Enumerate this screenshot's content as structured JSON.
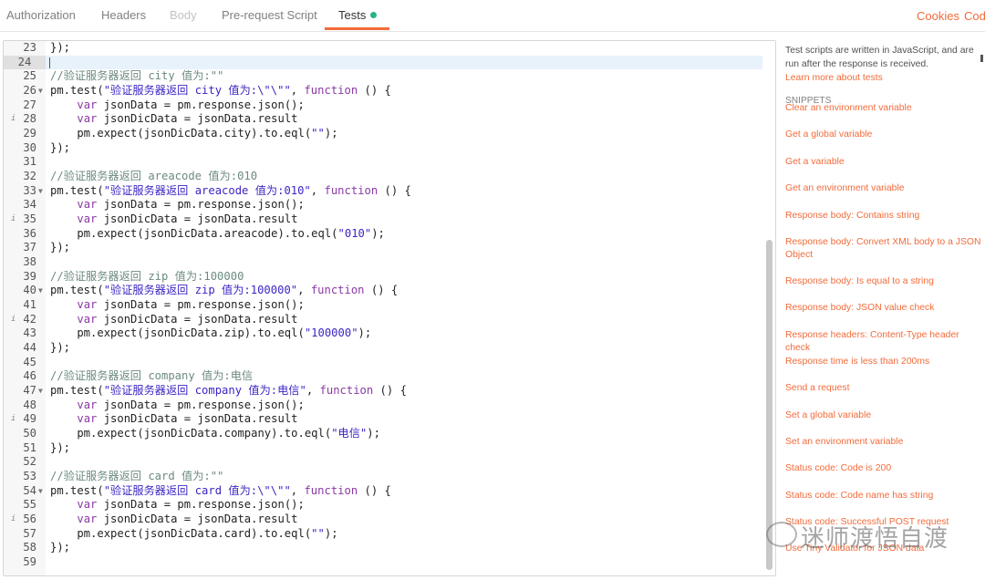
{
  "tabs": [
    {
      "label": "Authorization"
    },
    {
      "label": "Headers"
    },
    {
      "label": "Body"
    },
    {
      "label": "Pre-request Script"
    },
    {
      "label": "Tests"
    }
  ],
  "top_right": {
    "cookies": "Cookies",
    "code": "Code"
  },
  "editor": {
    "lines": [
      {
        "n": "23",
        "t": [
          [
            "});",
            ""
          ]
        ]
      },
      {
        "n": "24",
        "t": []
      },
      {
        "n": "25",
        "t": [
          [
            "//验证服务器返回 city 值为:\"\"",
            "cm"
          ]
        ]
      },
      {
        "n": "26",
        "fold": true,
        "t": [
          [
            "pm.test(",
            ""
          ],
          [
            "\"验证服务器返回 city 值为:\\\"\\\"\"",
            "st"
          ],
          [
            ", ",
            ""
          ],
          [
            "function",
            "kw"
          ],
          [
            " () {",
            ""
          ]
        ]
      },
      {
        "n": "27",
        "t": [
          [
            "    ",
            ""
          ],
          [
            "var",
            "kw"
          ],
          [
            " jsonData = pm.response.json();",
            ""
          ]
        ]
      },
      {
        "n": "28",
        "info": true,
        "t": [
          [
            "    ",
            ""
          ],
          [
            "var",
            "kw"
          ],
          [
            " jsonDicData = jsonData.result",
            ""
          ]
        ]
      },
      {
        "n": "29",
        "t": [
          [
            "    pm.expect(jsonDicData.city).to.eql(",
            ""
          ],
          [
            "\"\"",
            "st"
          ],
          [
            ");",
            ""
          ]
        ]
      },
      {
        "n": "30",
        "t": [
          [
            "});",
            ""
          ]
        ]
      },
      {
        "n": "31",
        "t": []
      },
      {
        "n": "32",
        "t": [
          [
            "//验证服务器返回 areacode 值为:010",
            "cm"
          ]
        ]
      },
      {
        "n": "33",
        "fold": true,
        "t": [
          [
            "pm.test(",
            ""
          ],
          [
            "\"验证服务器返回 areacode 值为:010\"",
            "st"
          ],
          [
            ", ",
            ""
          ],
          [
            "function",
            "kw"
          ],
          [
            " () {",
            ""
          ]
        ]
      },
      {
        "n": "34",
        "t": [
          [
            "    ",
            ""
          ],
          [
            "var",
            "kw"
          ],
          [
            " jsonData = pm.response.json();",
            ""
          ]
        ]
      },
      {
        "n": "35",
        "info": true,
        "t": [
          [
            "    ",
            ""
          ],
          [
            "var",
            "kw"
          ],
          [
            " jsonDicData = jsonData.result",
            ""
          ]
        ]
      },
      {
        "n": "36",
        "t": [
          [
            "    pm.expect(jsonDicData.areacode).to.eql(",
            ""
          ],
          [
            "\"010\"",
            "st"
          ],
          [
            ");",
            ""
          ]
        ]
      },
      {
        "n": "37",
        "t": [
          [
            "});",
            ""
          ]
        ]
      },
      {
        "n": "38",
        "t": []
      },
      {
        "n": "39",
        "t": [
          [
            "//验证服务器返回 zip 值为:100000",
            "cm"
          ]
        ]
      },
      {
        "n": "40",
        "fold": true,
        "t": [
          [
            "pm.test(",
            ""
          ],
          [
            "\"验证服务器返回 zip 值为:100000\"",
            "st"
          ],
          [
            ", ",
            ""
          ],
          [
            "function",
            "kw"
          ],
          [
            " () {",
            ""
          ]
        ]
      },
      {
        "n": "41",
        "t": [
          [
            "    ",
            ""
          ],
          [
            "var",
            "kw"
          ],
          [
            " jsonData = pm.response.json();",
            ""
          ]
        ]
      },
      {
        "n": "42",
        "info": true,
        "t": [
          [
            "    ",
            ""
          ],
          [
            "var",
            "kw"
          ],
          [
            " jsonDicData = jsonData.result",
            ""
          ]
        ]
      },
      {
        "n": "43",
        "t": [
          [
            "    pm.expect(jsonDicData.zip).to.eql(",
            ""
          ],
          [
            "\"100000\"",
            "st"
          ],
          [
            ");",
            ""
          ]
        ]
      },
      {
        "n": "44",
        "t": [
          [
            "});",
            ""
          ]
        ]
      },
      {
        "n": "45",
        "t": []
      },
      {
        "n": "46",
        "t": [
          [
            "//验证服务器返回 company 值为:电信",
            "cm"
          ]
        ]
      },
      {
        "n": "47",
        "fold": true,
        "t": [
          [
            "pm.test(",
            ""
          ],
          [
            "\"验证服务器返回 company 值为:电信\"",
            "st"
          ],
          [
            ", ",
            ""
          ],
          [
            "function",
            "kw"
          ],
          [
            " () {",
            ""
          ]
        ]
      },
      {
        "n": "48",
        "t": [
          [
            "    ",
            ""
          ],
          [
            "var",
            "kw"
          ],
          [
            " jsonData = pm.response.json();",
            ""
          ]
        ]
      },
      {
        "n": "49",
        "info": true,
        "t": [
          [
            "    ",
            ""
          ],
          [
            "var",
            "kw"
          ],
          [
            " jsonDicData = jsonData.result",
            ""
          ]
        ]
      },
      {
        "n": "50",
        "t": [
          [
            "    pm.expect(jsonDicData.company).to.eql(",
            ""
          ],
          [
            "\"电信\"",
            "st"
          ],
          [
            ");",
            ""
          ]
        ]
      },
      {
        "n": "51",
        "t": [
          [
            "});",
            ""
          ]
        ]
      },
      {
        "n": "52",
        "t": []
      },
      {
        "n": "53",
        "t": [
          [
            "//验证服务器返回 card 值为:\"\"",
            "cm"
          ]
        ]
      },
      {
        "n": "54",
        "fold": true,
        "t": [
          [
            "pm.test(",
            ""
          ],
          [
            "\"验证服务器返回 card 值为:\\\"\\\"\"",
            "st"
          ],
          [
            ", ",
            ""
          ],
          [
            "function",
            "kw"
          ],
          [
            " () {",
            ""
          ]
        ]
      },
      {
        "n": "55",
        "t": [
          [
            "    ",
            ""
          ],
          [
            "var",
            "kw"
          ],
          [
            " jsonData = pm.response.json();",
            ""
          ]
        ]
      },
      {
        "n": "56",
        "info": true,
        "t": [
          [
            "    ",
            ""
          ],
          [
            "var",
            "kw"
          ],
          [
            " jsonDicData = jsonData.result",
            ""
          ]
        ]
      },
      {
        "n": "57",
        "t": [
          [
            "    pm.expect(jsonDicData.card).to.eql(",
            ""
          ],
          [
            "\"\"",
            "st"
          ],
          [
            ");",
            ""
          ]
        ]
      },
      {
        "n": "58",
        "t": [
          [
            "});",
            ""
          ]
        ]
      },
      {
        "n": "59",
        "t": []
      }
    ]
  },
  "sidebar": {
    "description": "Test scripts are written in JavaScript, and are run after the response is received.",
    "learn_more": "Learn more about tests",
    "snippets_heading": "SNIPPETS",
    "snippets": [
      "Clear an environment variable",
      "Get a global variable",
      "Get a variable",
      "Get an environment variable",
      "Response body: Contains string",
      "Response body: Convert XML body to a JSON Object",
      "Response body: Is equal to a string",
      "Response body: JSON value check",
      "Response headers: Content-Type header check",
      "Response time is less than 200ms",
      "Send a request",
      "Set a global variable",
      "Set an environment variable",
      "Status code: Code is 200",
      "Status code: Code name has string",
      "Status code: Successful POST request",
      "Use Tiny Validator for JSON data"
    ]
  },
  "watermark": "迷师渡悟自渡",
  "colors": {
    "accent": "#f26b3a",
    "tests_dot": "#26b47f"
  }
}
